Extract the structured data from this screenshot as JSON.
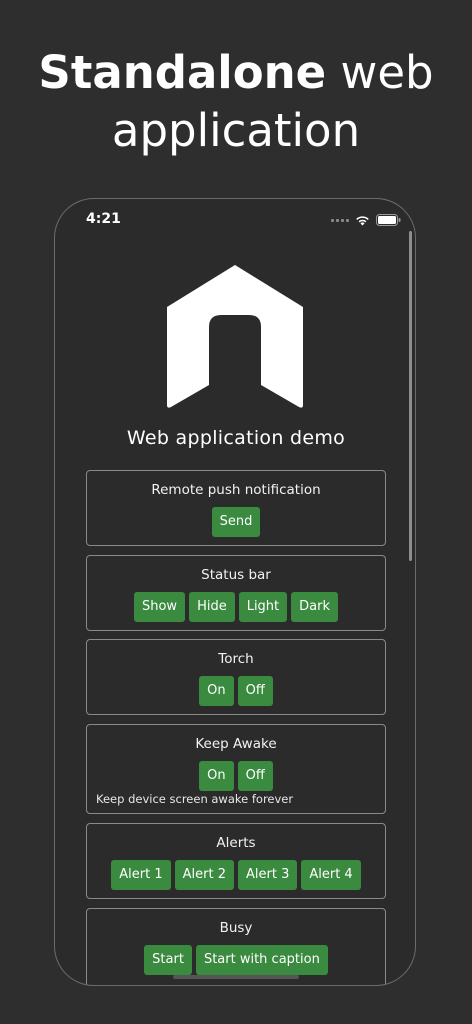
{
  "headline": {
    "bold": "Standalone",
    "rest_line1": " web",
    "line2": "application"
  },
  "status_bar": {
    "time": "4:21"
  },
  "app": {
    "title": "Web application demo"
  },
  "cards": {
    "push": {
      "title": "Remote push notification",
      "send": "Send"
    },
    "status": {
      "title": "Status bar",
      "show": "Show",
      "hide": "Hide",
      "light": "Light",
      "dark": "Dark"
    },
    "torch": {
      "title": "Torch",
      "on": "On",
      "off": "Off"
    },
    "awake": {
      "title": "Keep Awake",
      "on": "On",
      "off": "Off",
      "note": "Keep device screen awake forever"
    },
    "alerts": {
      "title": "Alerts",
      "a1": "Alert 1",
      "a2": "Alert 2",
      "a3": "Alert 3",
      "a4": "Alert 4"
    },
    "busy": {
      "title": "Busy",
      "start": "Start",
      "start_caption": "Start with caption"
    }
  },
  "colors": {
    "background": "#2e2e2e",
    "button": "#3a8a3f",
    "card_border": "#8a8a8a"
  }
}
